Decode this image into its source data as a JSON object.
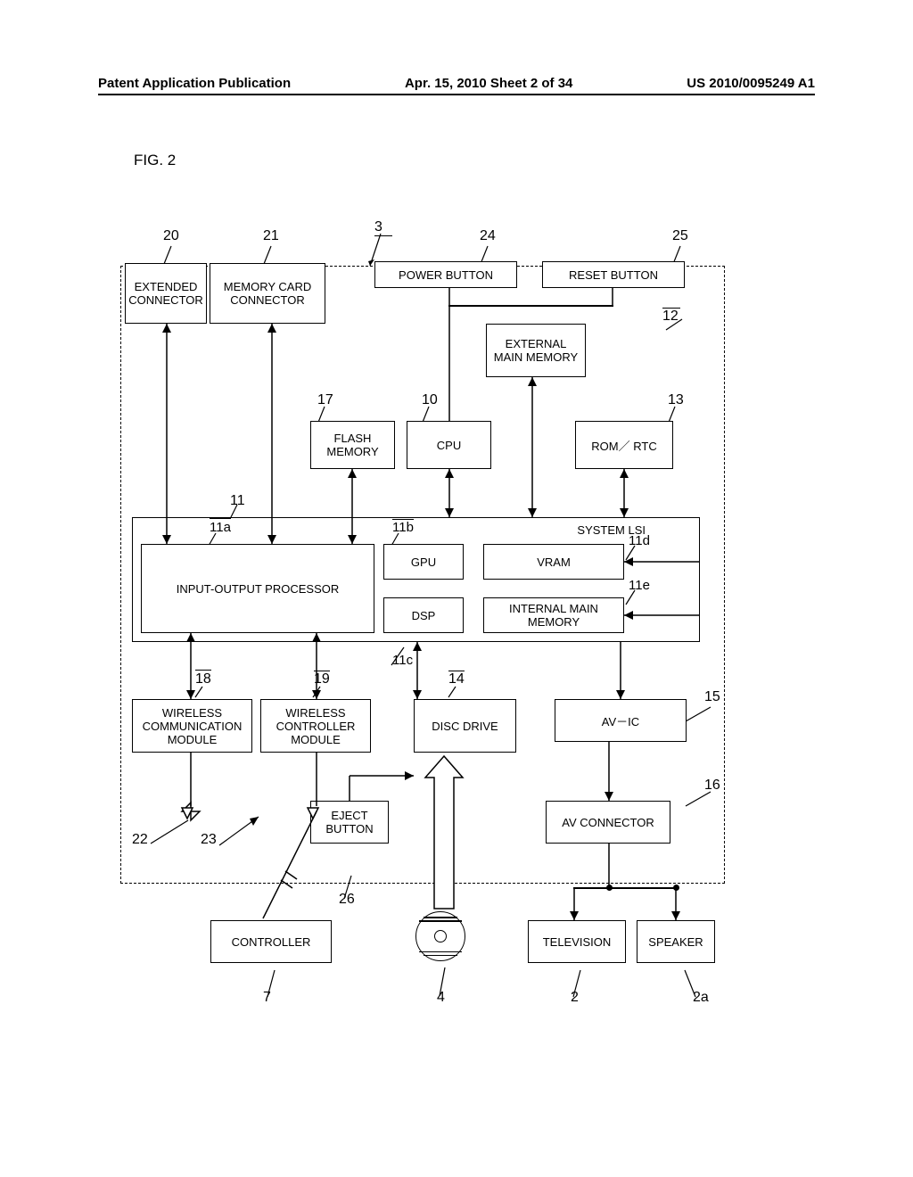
{
  "header": {
    "left": "Patent Application Publication",
    "center": "Apr. 15, 2010  Sheet 2 of 34",
    "right": "US 2010/0095249 A1"
  },
  "figLabel": "FIG. 2",
  "refs": {
    "r3": "3",
    "r20": "20",
    "r21": "21",
    "r24": "24",
    "r25": "25",
    "r12": "12",
    "r17": "17",
    "r10": "10",
    "r13": "13",
    "r11": "11",
    "r11a": "11a",
    "r11b": "11b",
    "r11c": "11c",
    "r11d": "11d",
    "r11e": "11e",
    "r18": "18",
    "r19": "19",
    "r14": "14",
    "r15": "15",
    "r16": "16",
    "r22": "22",
    "r23": "23",
    "r26": "26",
    "r7": "7",
    "r4": "4",
    "r2": "2",
    "r2a": "2a"
  },
  "blocks": {
    "extConnector": "EXTENDED CONNECTOR",
    "memCardConnector": "MEMORY CARD CONNECTOR",
    "powerButton": "POWER BUTTON",
    "resetButton": "RESET BUTTON",
    "extMainMem": "EXTERNAL MAIN MEMORY",
    "flashMem": "FLASH MEMORY",
    "cpu": "CPU",
    "romRtc": "ROM／ RTC",
    "systemLsi": "SYSTEM LSI",
    "ioProcessor": "INPUT-OUTPUT PROCESSOR",
    "gpu": "GPU",
    "vram": "VRAM",
    "dsp": "DSP",
    "intMainMem": "INTERNAL MAIN MEMORY",
    "wirelessComm": "WIRELESS COMMUNICATION MODULE",
    "wirelessCtrl": "WIRELESS CONTROLLER MODULE",
    "discDrive": "DISC DRIVE",
    "avic": "AV－IC",
    "ejectButton": "EJECT BUTTON",
    "avConnector": "AV CONNECTOR",
    "controller": "CONTROLLER",
    "television": "TELEVISION",
    "speaker": "SPEAKER"
  }
}
